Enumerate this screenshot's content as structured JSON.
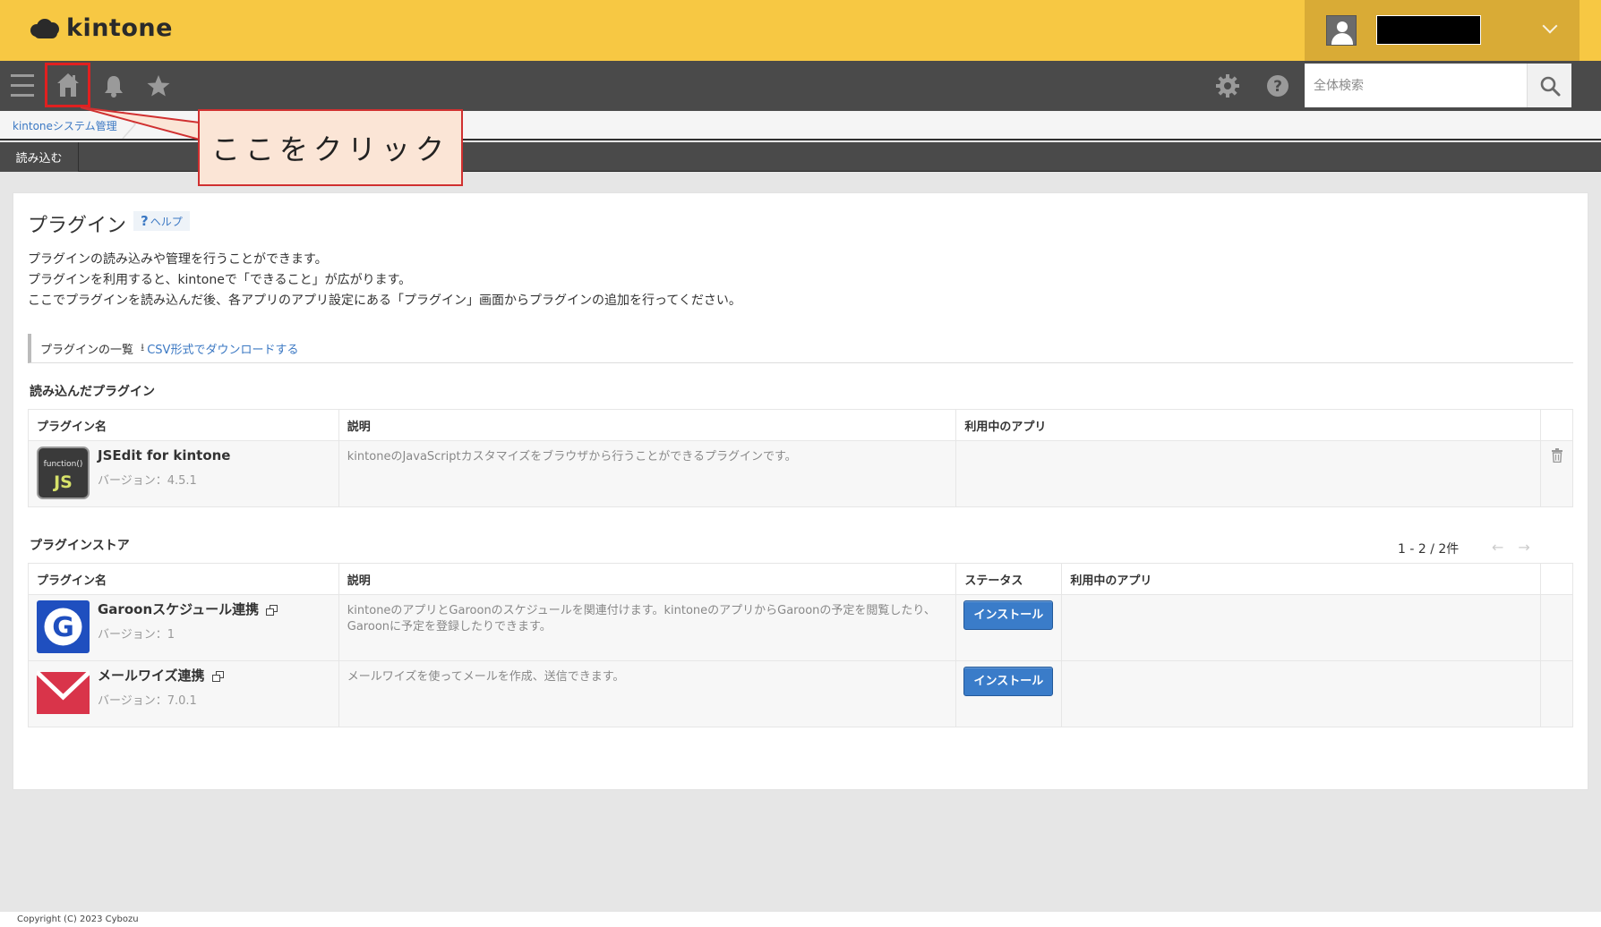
{
  "header": {
    "logo_text": "kintone"
  },
  "nav": {
    "search_placeholder": "全体検索"
  },
  "breadcrumb": {
    "item1": "kintoneシステム管理"
  },
  "actionbar": {
    "import_label": "読み込む"
  },
  "callout": {
    "text": "ここをクリック"
  },
  "page": {
    "title": "プラグイン",
    "help_label": "ヘルプ",
    "help_q": "?",
    "intro": [
      "プラグインの読み込みや管理を行うことができます。",
      "プラグインを利用すると、kintoneで「できること」が広がります。",
      "ここでプラグインを読み込んだ後、各アプリのアプリ設定にある「プラグイン」画面からプラグインの追加を行ってください。"
    ],
    "list_head": "プラグインの一覧",
    "csv_link": "CSV形式でダウンロードする"
  },
  "loaded": {
    "section_title": "読み込んだプラグイン",
    "columns": [
      "プラグイン名",
      "説明",
      "利用中のアプリ"
    ],
    "rows": [
      {
        "name": "JSEdit for kintone",
        "version": "バージョン：4.5.1",
        "description": "kintoneのJavaScriptカスタマイズをブラウザから行うことができるプラグインです。",
        "icon_top": "function()",
        "icon_main": "JS"
      }
    ]
  },
  "store": {
    "section_title": "プラグインストア",
    "pager": "1 - 2 / 2件",
    "columns": [
      "プラグイン名",
      "説明",
      "ステータス",
      "利用中のアプリ"
    ],
    "install_label": "インストール",
    "rows": [
      {
        "name": "Garoonスケジュール連携",
        "version": "バージョン：1",
        "description_line1": "kintoneのアプリとGaroonのスケジュールを関連付けます。kintoneのアプリからGaroonの予定を閲覧したり、",
        "description_line2": "Garoonに予定を登録したりできます。",
        "icon_letter": "G"
      },
      {
        "name": "メールワイズ連携",
        "version": "バージョン：7.0.1",
        "description_line1": "メールワイズを使ってメールを作成、送信できます。"
      }
    ]
  },
  "footer": {
    "copyright": "Copyright (C) 2023 Cybozu"
  },
  "colors": {
    "header_yellow": "#f7c843",
    "nav_dark": "#4a4a4a",
    "link_blue": "#3b78c3",
    "install_blue": "#3a7cc9",
    "callout_red": "#d03030"
  }
}
